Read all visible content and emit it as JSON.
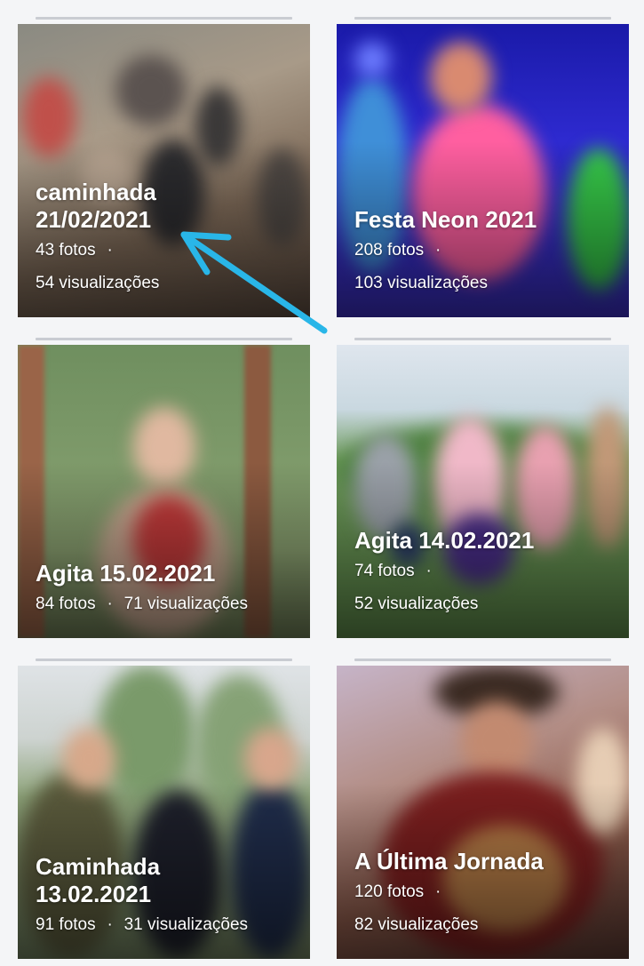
{
  "albums": [
    {
      "title": "caminhada 21/02/2021",
      "photos": "43 fotos",
      "views": "54 visualizações"
    },
    {
      "title": "Festa Neon 2021",
      "photos": "208 fotos",
      "views": "103 visualizações"
    },
    {
      "title": "Agita 15.02.2021",
      "photos": "84 fotos",
      "views": "71 visualizações"
    },
    {
      "title": "Agita 14.02.2021",
      "photos": "74 fotos",
      "views": "52 visualizações"
    },
    {
      "title": "Caminhada 13.02.2021",
      "photos": "91 fotos",
      "views": "31 visualizações"
    },
    {
      "title": "A Última Jornada",
      "photos": "120 fotos",
      "views": "82 visualizações"
    }
  ],
  "separator": "·",
  "annotation": {
    "icon": "arrow-icon",
    "color": "#29b6e8"
  }
}
